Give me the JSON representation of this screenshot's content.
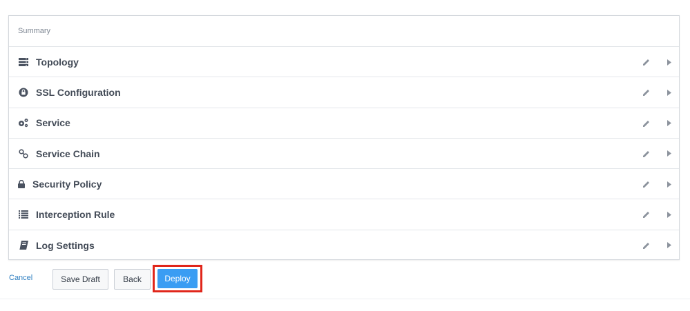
{
  "summary": {
    "header": "Summary",
    "rows": [
      {
        "label": "Topology",
        "icon": "server-icon"
      },
      {
        "label": "SSL Configuration",
        "icon": "ssl-lock-icon"
      },
      {
        "label": "Service",
        "icon": "gears-icon"
      },
      {
        "label": "Service Chain",
        "icon": "link-icon"
      },
      {
        "label": "Security Policy",
        "icon": "lock-icon"
      },
      {
        "label": "Interception Rule",
        "icon": "list-icon"
      },
      {
        "label": "Log Settings",
        "icon": "book-icon"
      }
    ]
  },
  "footer": {
    "cancel_label": "Cancel",
    "save_draft_label": "Save Draft",
    "back_label": "Back",
    "deploy_label": "Deploy"
  },
  "colors": {
    "accent": "#3a9df3",
    "highlight": "#e0261b",
    "link": "#2f7fc1"
  }
}
